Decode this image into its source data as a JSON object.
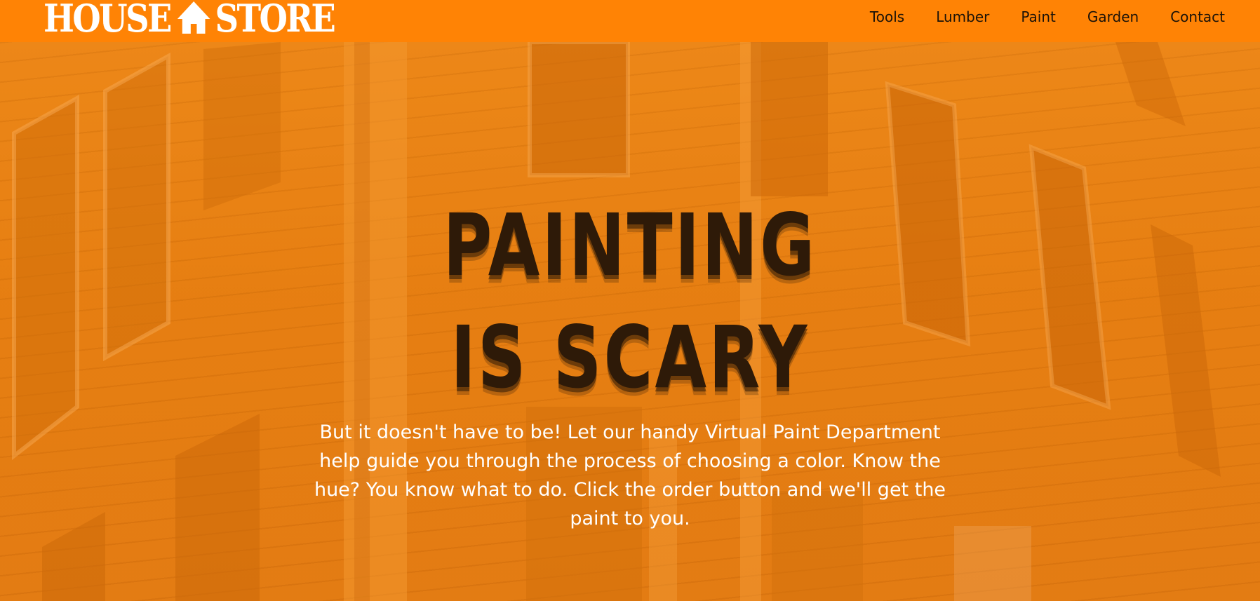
{
  "header": {
    "logo_left": "HOUSE",
    "logo_right": "STORE",
    "logo_icon": "house-icon",
    "background_color": "#ff8305",
    "nav": [
      {
        "label": "Tools"
      },
      {
        "label": "Lumber"
      },
      {
        "label": "Paint"
      },
      {
        "label": "Garden"
      },
      {
        "label": "Contact"
      }
    ]
  },
  "hero": {
    "title": "PAINTING IS SCARY",
    "body": "But it doesn't have to be! Let our handy Virtual Paint Department help guide you through the process of choosing a color. Know the hue? You know what to do. Click the order button and we'll get the paint to you.",
    "title_color": "#2e1a08",
    "overlay_color": "#e37a10"
  }
}
